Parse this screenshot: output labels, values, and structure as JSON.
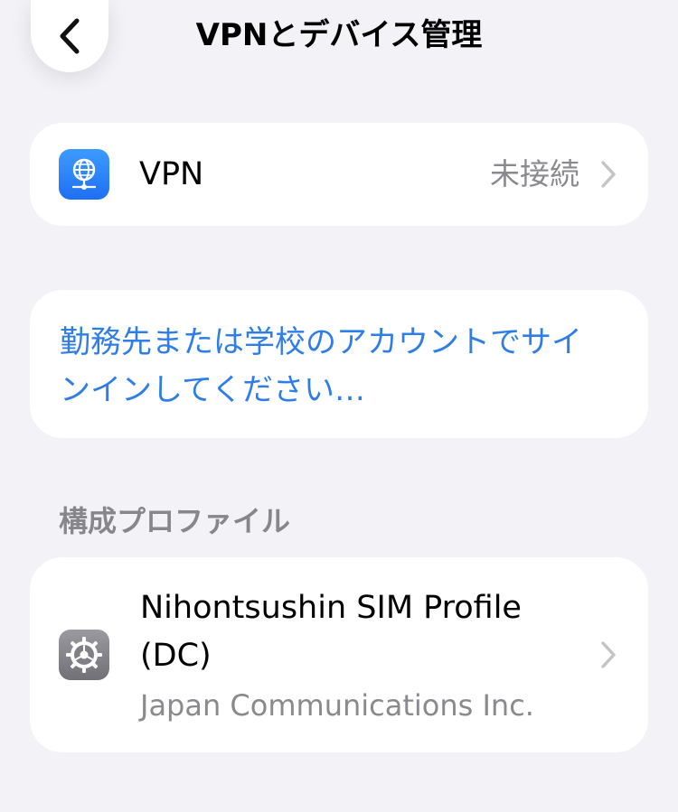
{
  "header": {
    "title": "VPNとデバイス管理",
    "back_icon": "chevron-left-icon"
  },
  "vpn_row": {
    "icon": "globe-network-icon",
    "icon_color": "#2f80f5",
    "label": "VPN",
    "status": "未接続",
    "chevron_icon": "chevron-right-icon"
  },
  "signin": {
    "link_text": "勤務先または学校のアカウントでサインインしてください…",
    "color": "#2f7ee8"
  },
  "profiles_section": {
    "header": "構成プロファイル",
    "items": [
      {
        "icon": "settings-gear-icon",
        "name": "Nihontsushin SIM Profile (DC)",
        "organization": "Japan Communications Inc.",
        "chevron_icon": "chevron-right-icon"
      }
    ]
  },
  "colors": {
    "background": "#f2f2f7",
    "card": "#ffffff",
    "secondary_text": "#8a8a8e",
    "accent": "#2f7ee8"
  }
}
